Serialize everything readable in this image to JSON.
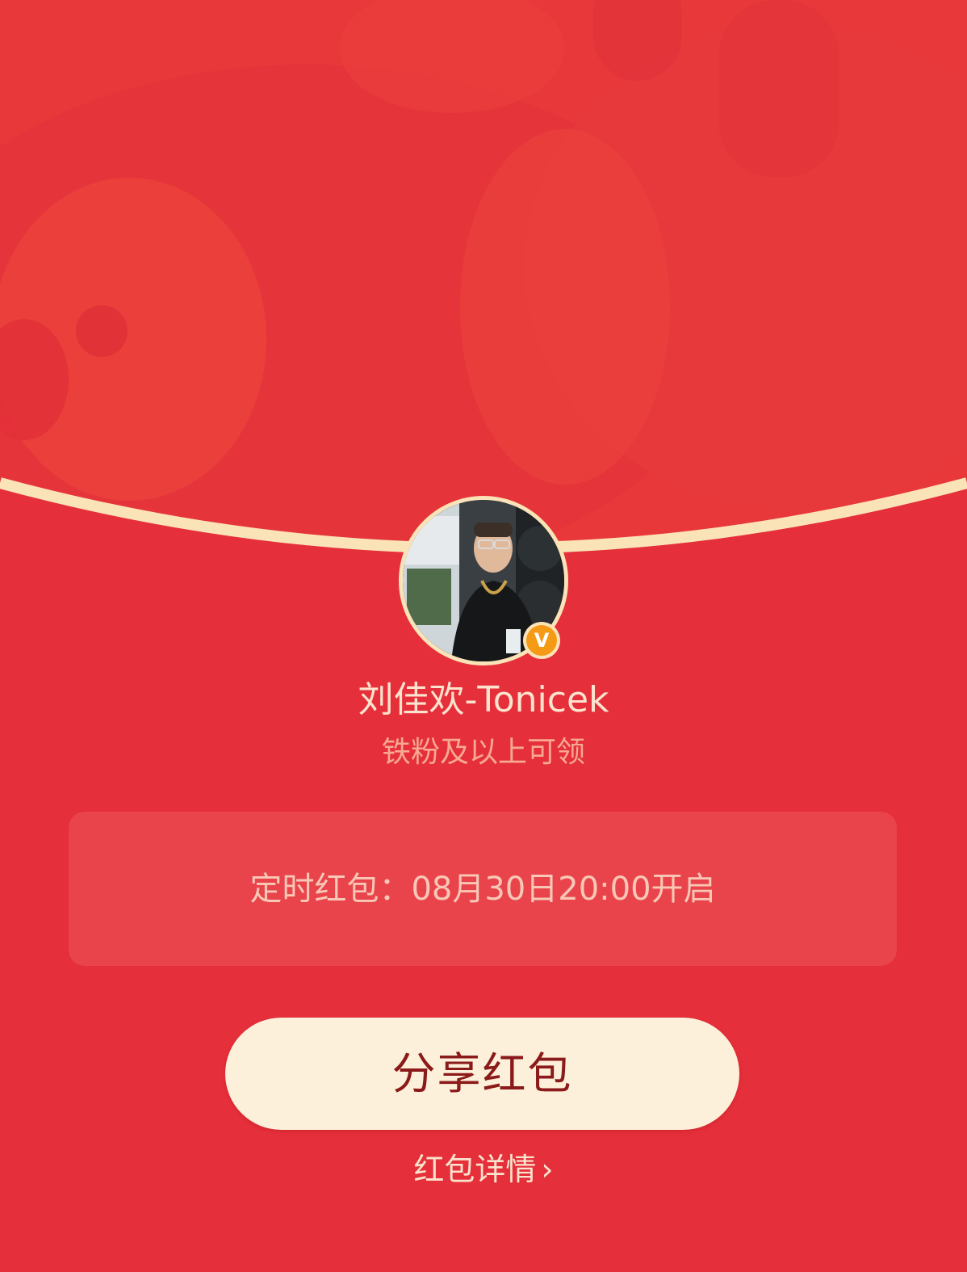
{
  "sender": {
    "name": "刘佳欢-Tonicek",
    "verified_badge_letter": "V",
    "eligibility": "铁粉及以上可领"
  },
  "red_packet": {
    "schedule_text": "定时红包：08月30日20:00开启"
  },
  "actions": {
    "share_label": "分享红包",
    "details_label": "红包详情",
    "details_chevron": "›"
  },
  "icons": {
    "avatar": "profile-photo",
    "verified": "verified-v-icon",
    "chevron": "chevron-right-icon"
  },
  "colors": {
    "background": "#e52f3b",
    "top_background": "#ea3f3c",
    "arc_gold": "#fbe3b8",
    "button_background": "#fdf0da",
    "button_text": "#8b1a1a",
    "badge_orange": "#f59a14",
    "name_text": "#fbe3cd",
    "eligibility_text": "#f7a893",
    "timer_box": "#e9444c",
    "timer_text": "#f8c7b5"
  }
}
